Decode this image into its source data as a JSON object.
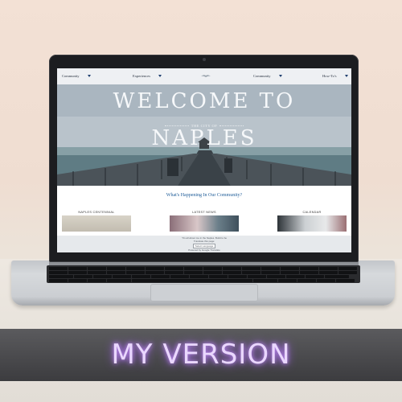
{
  "nav": {
    "items": [
      "Community",
      "Experiences",
      "Community",
      "How-To's"
    ]
  },
  "hero": {
    "line1": "WELCOME TO",
    "subtitle": "THE CITY OF",
    "line2": "NAPLES"
  },
  "main": {
    "heading": "What's Happening In Our Community?",
    "cards": [
      {
        "label": "NAPLES CENTENNIAL"
      },
      {
        "label": "LATEST NEWS"
      },
      {
        "label": "CALENDAR"
      }
    ]
  },
  "footer": {
    "line1": "\"It's all about me in the Naples. Build to be",
    "line2": "Translate this page:",
    "select_value": "Select Language",
    "powered": "Powered by Google Translate"
  },
  "banner": {
    "text": "MY VERSION"
  },
  "colors": {
    "heading": "#1e5c98",
    "banner_glow": "#c990ff"
  }
}
